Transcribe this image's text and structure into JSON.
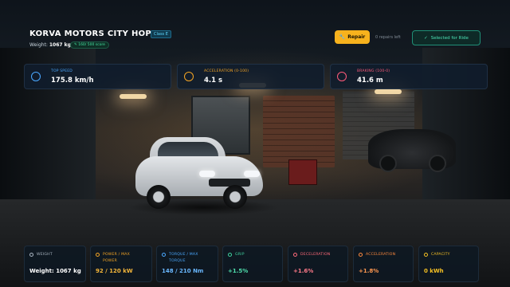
{
  "header": {
    "title": "KORVA MOTORS CITY HOPPER",
    "class_badge": "Class E",
    "weight_label": "Weight:",
    "weight_value": "1067 kg",
    "score_badge": "160/ 500 score",
    "repair_label": "Repair",
    "repairs_left": "0 repairs left",
    "ride_label": "Selected for Ride"
  },
  "top_stats": [
    {
      "label": "TOP SPEED",
      "value": "175.8 km/h",
      "color": "#4aa8ff",
      "icon": "speedometer-icon"
    },
    {
      "label": "ACCELERATION (0-100)",
      "value": "4.1 s",
      "color": "#f5a524",
      "icon": "stopwatch-icon"
    },
    {
      "label": "BRAKING (100-0)",
      "value": "41.6 m",
      "color": "#ff5a7a",
      "icon": "brake-icon"
    }
  ],
  "bottom_stats": [
    {
      "label": "WEIGHT",
      "value": "Weight: 1067 kg",
      "color": "#aab6c2",
      "value_color": "#ffffff",
      "icon": "gear-icon"
    },
    {
      "label": "POWER / MAX POWER",
      "value": "92 / 120 kW",
      "color": "#f5a524",
      "value_color": "#f5b73a",
      "icon": "lightning-icon"
    },
    {
      "label": "TORQUE / MAX TORQUE",
      "value": "148 / 210 Nm",
      "color": "#4aa8ff",
      "value_color": "#6ab8ff",
      "icon": "torque-icon"
    },
    {
      "label": "GRIP",
      "value": "+1.5%",
      "color": "#3fd3a0",
      "value_color": "#4fe0ad",
      "icon": "shield-icon"
    },
    {
      "label": "DECELERATION",
      "value": "+1.6%",
      "color": "#ff6a7a",
      "value_color": "#ff7a88",
      "icon": "deceleration-icon"
    },
    {
      "label": "ACCELERATION",
      "value": "+1.8%",
      "color": "#ff8a3d",
      "value_color": "#ff9850",
      "icon": "flame-icon"
    },
    {
      "label": "CAPACITY",
      "value": "0 kWh",
      "color": "#f5c023",
      "value_color": "#f5c023",
      "icon": "battery-icon"
    }
  ]
}
